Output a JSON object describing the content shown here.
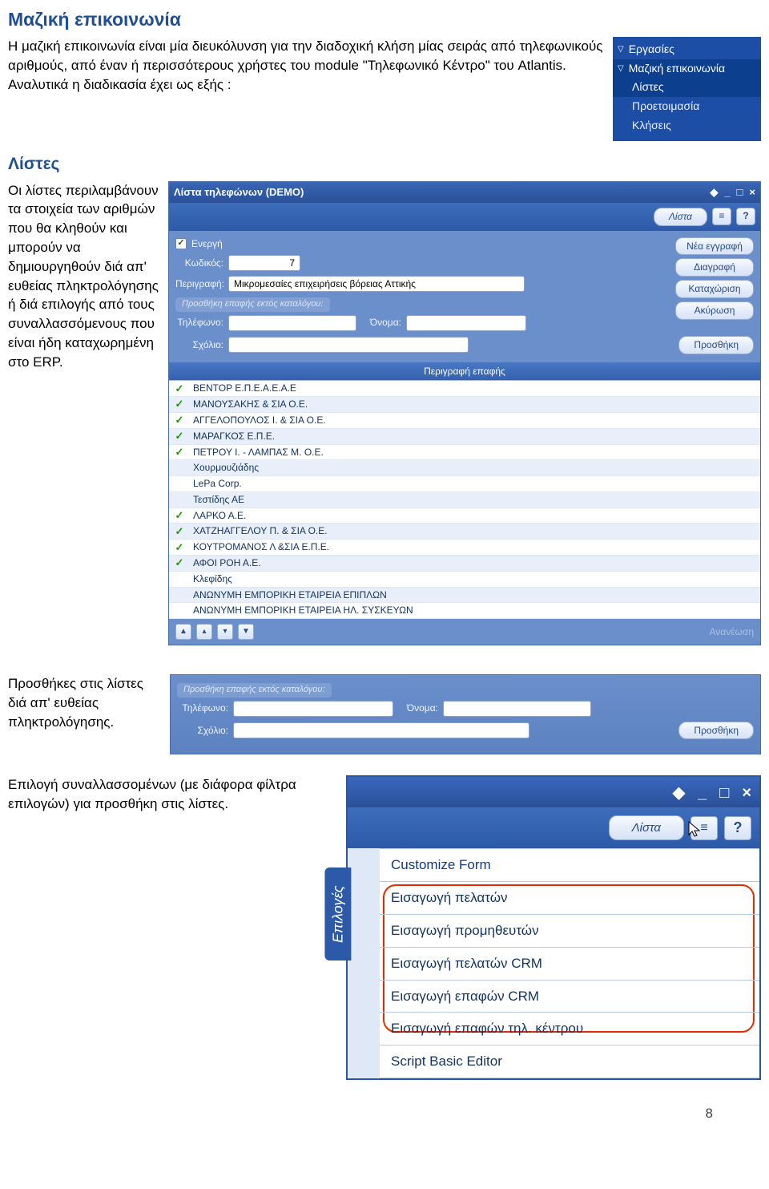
{
  "page_title": "Μαζική επικοινωνία",
  "intro": "Η μαζική επικοινωνία είναι μία διευκόλυνση για την διαδοχική κλήση μίας σειράς από τηλεφωνικούς αριθμούς, από έναν ή περισσότερους χρήστες του module \"Τηλεφωνικό Κέντρο\" του Atlantis. Αναλυτικά η διαδικασία έχει ως εξής :",
  "nav": {
    "ergasies": "Εργασίες",
    "maziki": "Μαζική επικοινωνία",
    "listes": "Λίστες",
    "proetoimasia": "Προετοιμασία",
    "kliseis": "Κλήσεις"
  },
  "lists": {
    "heading": "Λίστες",
    "text": "Οι λίστες περιλαμβάνουν τα στοιχεία των αριθμών που θα κληθούν και μπορούν να δημιουργηθούν διά απ' ευθείας πληκτρολόγησης ή διά επιλογής από τους συναλλασσόμενους που είναι ήδη καταχωρημένη στο ERP."
  },
  "window": {
    "title": "Λίστα τηλεφώνων (DEMO)",
    "list_btn": "Λίστα",
    "help": "?",
    "form": {
      "energi_label": "Ενεργή",
      "kodikos_label": "Κωδικός:",
      "kodikos_value": "7",
      "perigrafi_label": "Περιγραφή:",
      "perigrafi_value": "Μικρομεσαίες επιχειρήσεις βόρειας Αττικής",
      "subpanel": "Προσθήκη επαφής εκτός καταλόγου:",
      "tilefono_label": "Τηλέφωνο:",
      "onoma_label": "Όνομα:",
      "sxolio_label": "Σχόλιο:",
      "prosthiki_btn": "Προσθήκη"
    },
    "actions": {
      "new": "Νέα εγγραφή",
      "delete": "Διαγραφή",
      "save": "Καταχώριση",
      "cancel": "Ακύρωση"
    },
    "grid_header": "Περιγραφή επαφής",
    "rows": [
      "BENTOP Ε.Π.Ε.Α.Ε.Α.Ε",
      "ΜΑΝΟΥΣΑΚΗΣ & ΣΙΑ Ο.Ε.",
      "ΑΓΓΕΛΟΠΟΥΛΟΣ Ι. & ΣΙΑ Ο.Ε.",
      "ΜΑΡΑΓΚΟΣ Ε.Π.Ε.",
      "ΠΕΤΡΟΥ Ι. - ΛΑΜΠΑΣ Μ. Ο.Ε.",
      "Χουρμουζιάδης",
      "LePa Corp.",
      "Τεστίδης ΑΕ",
      "ΛΑΡΚΟ Α.Ε.",
      "ΧΑΤΖΗΑΓΓΕΛΟΥ Π. & ΣΙΑ Ο.Ε.",
      "ΚΟΥΤΡΟΜΑΝΟΣ Λ &ΣΙΑ Ε.Π.Ε.",
      "ΑΦΟΙ ΡΟΗ Α.Ε.",
      "Κλεφίδης",
      "ΑΝΩΝΥΜΗ ΕΜΠΟΡΙΚΗ ΕΤΑΙΡΕΙΑ ΕΠΙΠΛΩΝ",
      "ΑΝΩΝΥΜΗ ΕΜΠΟΡΙΚΗ ΕΤΑΙΡΕΙΑ ΗΛ. ΣΥΣΚΕΥΩΝ"
    ],
    "refresh": "Ανανέωση"
  },
  "add_block": {
    "text": "Προσθήκες στις λίστες διά απ' ευθείας πληκτρολόγησης.",
    "subpanel": "Προσθήκη επαφής εκτός καταλόγου:",
    "tilefono": "Τηλέφωνο:",
    "onoma": "Όνομα:",
    "sxolio": "Σχόλιο:",
    "btn": "Προσθήκη"
  },
  "third_block": {
    "text": "Επιλογή συναλλασσομένων (με διάφορα φίλτρα επιλογών) για προσθήκη στις λίστες.",
    "list_btn": "Λίστα",
    "help": "?",
    "side_label": "Επιλογές",
    "menu": [
      "Customize Form",
      "Εισαγωγή πελατών",
      "Εισαγωγή προμηθευτών",
      "Εισαγωγή πελατών CRM",
      "Εισαγωγή επαφών CRM",
      "Εισαγωγή επαφών τηλ. κέντρου",
      "Script Basic Editor"
    ]
  },
  "page_number": "8"
}
